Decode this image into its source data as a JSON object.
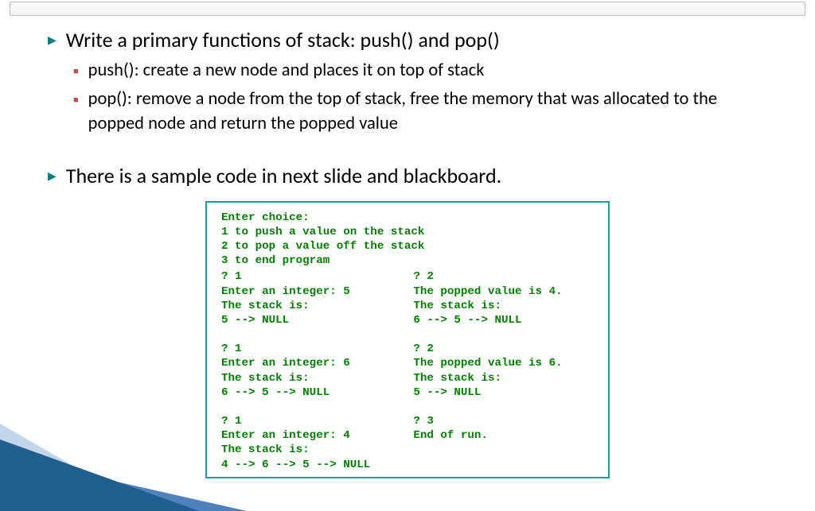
{
  "bullets": {
    "main1": "Write a primary functions of stack: push() and pop()",
    "sub1": "push():  create a new node and places it on top of stack",
    "sub2": "pop(): remove a node from the top of stack, free the memory that was allocated to the popped node and return the popped value",
    "main2": "There is a sample code in next slide and blackboard."
  },
  "code": {
    "header": "Enter choice:\n1 to push a value on the stack\n2 to pop a value off the stack\n3 to end program",
    "left": "? 1\nEnter an integer: 5\nThe stack is:\n5 --> NULL\n\n? 1\nEnter an integer: 6\nThe stack is:\n6 --> 5 --> NULL\n\n? 1\nEnter an integer: 4\nThe stack is:\n4 --> 6 --> 5 --> NULL",
    "right": "? 2\nThe popped value is 4.\nThe stack is:\n6 --> 5 --> NULL\n\n? 2\nThe popped value is 6.\nThe stack is:\n5 --> NULL\n\n? 3\nEnd of run."
  }
}
